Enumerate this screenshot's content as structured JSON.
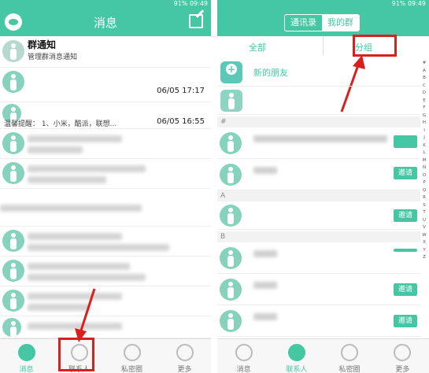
{
  "left": {
    "status": {
      "time": "09:49",
      "battery": "91%"
    },
    "header": {
      "title": "消息"
    },
    "conversations": [
      {
        "name": "群通知",
        "sub": "管理群消息通知",
        "time": ""
      },
      {
        "name": "",
        "sub": "",
        "time": "06/05 17:17"
      },
      {
        "name": "",
        "sub": "温馨提醒：  1、小米，酷派，联想...",
        "time": "06/05 16:55"
      }
    ],
    "tabs": [
      "消息",
      "联系人",
      "私密圈",
      "更多"
    ]
  },
  "right": {
    "status": {
      "time": "09:49",
      "battery": "91%"
    },
    "segments": [
      "通讯录",
      "我的群"
    ],
    "filters": {
      "all": "全部",
      "group": "分组"
    },
    "new_friend": "新的朋友",
    "sections": [
      "#",
      "A",
      "B"
    ],
    "invite_label": "邀请",
    "index_letters": [
      "#",
      "A",
      "B",
      "C",
      "D",
      "E",
      "F",
      "G",
      "H",
      "I",
      "J",
      "K",
      "L",
      "M",
      "N",
      "O",
      "P",
      "Q",
      "R",
      "S",
      "T",
      "U",
      "V",
      "W",
      "X",
      "Y",
      "Z"
    ],
    "tabs": [
      "消息",
      "联系人",
      "私密圈",
      "更多"
    ]
  },
  "colors": {
    "accent": "#45c7a4",
    "annotation": "#d9201f"
  }
}
